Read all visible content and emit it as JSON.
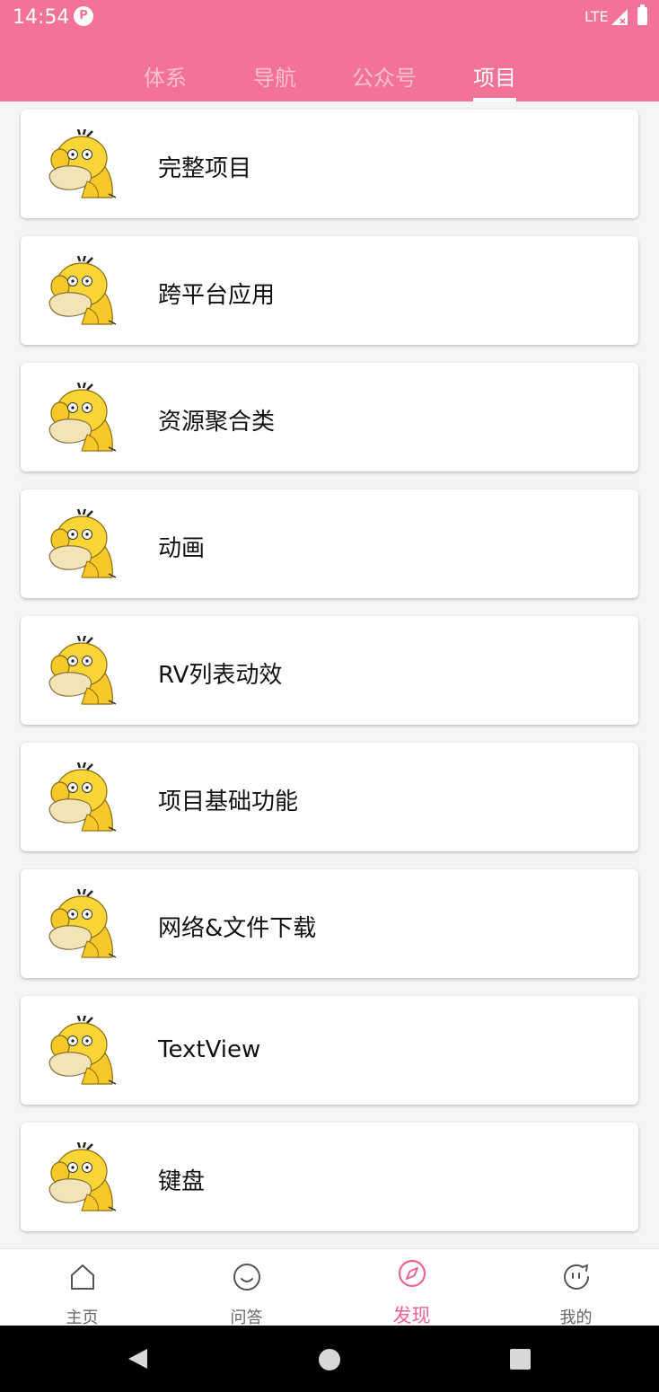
{
  "status_bar": {
    "time": "14:54",
    "app_icon": "P",
    "network": "LTE",
    "signal_icon": "signal-icon",
    "battery_icon": "battery-icon"
  },
  "tabs": [
    {
      "label": "体系",
      "active": false
    },
    {
      "label": "导航",
      "active": false
    },
    {
      "label": "公众号",
      "active": false
    },
    {
      "label": "项目",
      "active": true
    }
  ],
  "items": [
    {
      "label": "完整项目",
      "icon": "psyduck-avatar"
    },
    {
      "label": "跨平台应用",
      "icon": "psyduck-avatar"
    },
    {
      "label": "资源聚合类",
      "icon": "psyduck-avatar"
    },
    {
      "label": "动画",
      "icon": "psyduck-avatar"
    },
    {
      "label": "RV列表动效",
      "icon": "psyduck-avatar"
    },
    {
      "label": "项目基础功能",
      "icon": "psyduck-avatar"
    },
    {
      "label": "网络&文件下载",
      "icon": "psyduck-avatar"
    },
    {
      "label": "TextView",
      "icon": "psyduck-avatar"
    },
    {
      "label": "键盘",
      "icon": "psyduck-avatar"
    }
  ],
  "bottom_nav": [
    {
      "label": "主页",
      "icon": "home-icon",
      "active": false
    },
    {
      "label": "问答",
      "icon": "chat-smile-icon",
      "active": false
    },
    {
      "label": "发现",
      "icon": "compass-icon",
      "active": true
    },
    {
      "label": "我的",
      "icon": "face-icon",
      "active": false
    }
  ],
  "colors": {
    "primary": "#f37297",
    "accent": "#f06292",
    "background": "#f5f5f5"
  }
}
